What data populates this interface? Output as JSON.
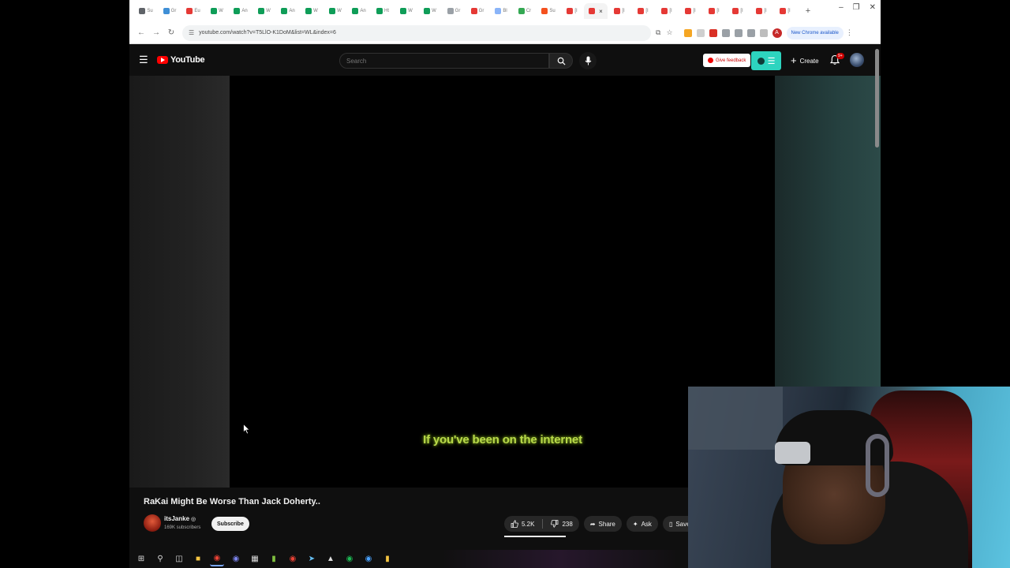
{
  "browser": {
    "tabs": [
      {
        "label": "Su",
        "favicon_color": "#5f6368"
      },
      {
        "label": "Gr",
        "favicon_color": "#3f8fd6"
      },
      {
        "label": "Eu",
        "favicon_color": "#e53935"
      },
      {
        "label": "W",
        "favicon_color": "#0f9d58"
      },
      {
        "label": "An",
        "favicon_color": "#0f9d58"
      },
      {
        "label": "W",
        "favicon_color": "#0f9d58"
      },
      {
        "label": "An",
        "favicon_color": "#0f9d58"
      },
      {
        "label": "W",
        "favicon_color": "#0f9d58"
      },
      {
        "label": "W",
        "favicon_color": "#0f9d58"
      },
      {
        "label": "An",
        "favicon_color": "#0f9d58"
      },
      {
        "label": "Ht",
        "favicon_color": "#0f9d58"
      },
      {
        "label": "W",
        "favicon_color": "#0f9d58"
      },
      {
        "label": "W",
        "favicon_color": "#0f9d58"
      },
      {
        "label": "Gr",
        "favicon_color": "#9aa0a6"
      },
      {
        "label": "Gr",
        "favicon_color": "#e53935"
      },
      {
        "label": "Bl",
        "favicon_color": "#8ab4f8"
      },
      {
        "label": "Cr",
        "favicon_color": "#34a853"
      },
      {
        "label": "Su",
        "favicon_color": "#f4511e"
      },
      {
        "label": "[I",
        "favicon_color": "#e53935"
      },
      {
        "label": "",
        "favicon_color": "#e53935",
        "active": true
      },
      {
        "label": "[I",
        "favicon_color": "#e53935"
      },
      {
        "label": "[I",
        "favicon_color": "#e53935"
      },
      {
        "label": "[I",
        "favicon_color": "#e53935"
      },
      {
        "label": "[I",
        "favicon_color": "#e53935"
      },
      {
        "label": "[I",
        "favicon_color": "#e53935"
      },
      {
        "label": "[I",
        "favicon_color": "#e53935"
      },
      {
        "label": "[I",
        "favicon_color": "#e53935"
      },
      {
        "label": "[I",
        "favicon_color": "#e53935"
      }
    ],
    "url": "youtube.com/watch?v=T5LlO-K1DoM&list=WL&index=6",
    "update_label": "New Chrome available",
    "profile_initial": "A"
  },
  "youtube": {
    "logo_text": "YouTube",
    "search_placeholder": "Search",
    "feedback_label": "Give feedback",
    "create_label": "Create",
    "notification_badge": "9+",
    "caption": "If you've been on the internet",
    "video_title": "RaKai Might Be Worse Than Jack Doherty..",
    "channel_name": "itsJanke",
    "verified_mark": "◎",
    "subscribers": "169K subscribers",
    "subscribe_label": "Subscribe",
    "likes": "5.2K",
    "dislikes": "238",
    "share_label": "Share",
    "ask_label": "Ask",
    "save_label": "Save"
  },
  "colors": {
    "brand_red": "#ff0000",
    "extension_teal": "#2dd4bf",
    "caption_green": "#b8d94a"
  }
}
